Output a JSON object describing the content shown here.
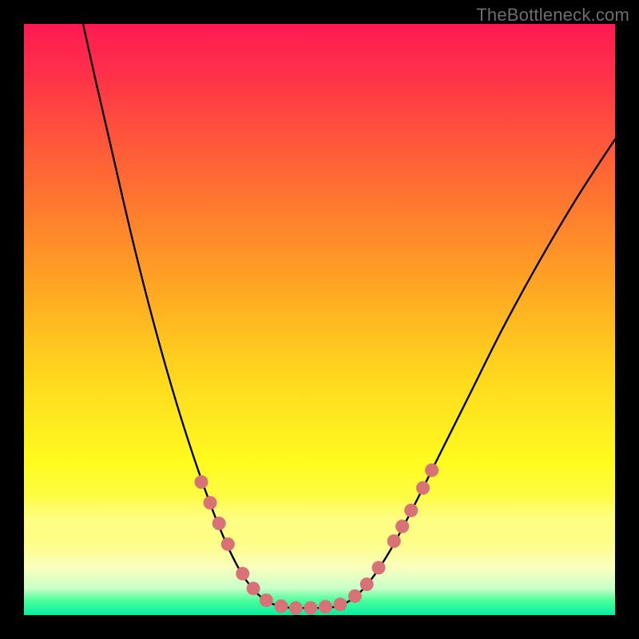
{
  "attribution": "TheBottleneck.com",
  "colors": {
    "frame": "#000000",
    "curve": "#000000",
    "dot_fill": "#d97277",
    "dot_stroke": "#c45a60"
  },
  "chart_data": {
    "type": "line",
    "title": "",
    "xlabel": "",
    "ylabel": "",
    "xlim": [
      0,
      100
    ],
    "ylim": [
      0,
      100
    ],
    "note": "X and Y are percentage-of-plot coordinates (origin top-left). The black curve is a V-shaped bottleneck curve. Dots cluster near the trough.",
    "series": [
      {
        "name": "bottleneck-curve-left",
        "kind": "path",
        "points": [
          {
            "x": 10.0,
            "y": 0.0
          },
          {
            "x": 12.0,
            "y": 9.0
          },
          {
            "x": 15.0,
            "y": 22.0
          },
          {
            "x": 18.0,
            "y": 35.0
          },
          {
            "x": 21.0,
            "y": 47.0
          },
          {
            "x": 24.0,
            "y": 58.0
          },
          {
            "x": 27.0,
            "y": 68.0
          },
          {
            "x": 30.0,
            "y": 77.0
          },
          {
            "x": 33.0,
            "y": 85.0
          },
          {
            "x": 36.0,
            "y": 91.5
          },
          {
            "x": 38.5,
            "y": 95.3
          },
          {
            "x": 41.0,
            "y": 97.6
          },
          {
            "x": 43.5,
            "y": 98.6
          }
        ]
      },
      {
        "name": "bottleneck-curve-bottom",
        "kind": "path",
        "points": [
          {
            "x": 43.5,
            "y": 98.6
          },
          {
            "x": 45.5,
            "y": 98.8
          },
          {
            "x": 48.0,
            "y": 98.8
          },
          {
            "x": 50.5,
            "y": 98.8
          },
          {
            "x": 53.0,
            "y": 98.6
          }
        ]
      },
      {
        "name": "bottleneck-curve-right",
        "kind": "path",
        "points": [
          {
            "x": 53.0,
            "y": 98.6
          },
          {
            "x": 55.5,
            "y": 97.3
          },
          {
            "x": 58.5,
            "y": 94.3
          },
          {
            "x": 62.0,
            "y": 89.0
          },
          {
            "x": 66.0,
            "y": 81.5
          },
          {
            "x": 70.5,
            "y": 72.5
          },
          {
            "x": 75.5,
            "y": 62.5
          },
          {
            "x": 81.0,
            "y": 51.5
          },
          {
            "x": 87.0,
            "y": 40.5
          },
          {
            "x": 93.5,
            "y": 29.5
          },
          {
            "x": 100.0,
            "y": 19.5
          }
        ]
      },
      {
        "name": "dots",
        "kind": "scatter",
        "points": [
          {
            "x": 30.0,
            "y": 77.5
          },
          {
            "x": 31.5,
            "y": 81.0
          },
          {
            "x": 33.0,
            "y": 84.5
          },
          {
            "x": 34.5,
            "y": 88.0
          },
          {
            "x": 37.0,
            "y": 93.0
          },
          {
            "x": 38.8,
            "y": 95.5
          },
          {
            "x": 41.0,
            "y": 97.5
          },
          {
            "x": 43.5,
            "y": 98.5
          },
          {
            "x": 46.0,
            "y": 98.8
          },
          {
            "x": 48.5,
            "y": 98.8
          },
          {
            "x": 51.0,
            "y": 98.6
          },
          {
            "x": 53.5,
            "y": 98.2
          },
          {
            "x": 56.0,
            "y": 96.8
          },
          {
            "x": 58.0,
            "y": 94.8
          },
          {
            "x": 60.0,
            "y": 92.0
          },
          {
            "x": 62.6,
            "y": 87.5
          },
          {
            "x": 64.0,
            "y": 85.0
          },
          {
            "x": 65.5,
            "y": 82.3
          },
          {
            "x": 67.5,
            "y": 78.5
          },
          {
            "x": 69.0,
            "y": 75.5
          }
        ]
      }
    ]
  }
}
